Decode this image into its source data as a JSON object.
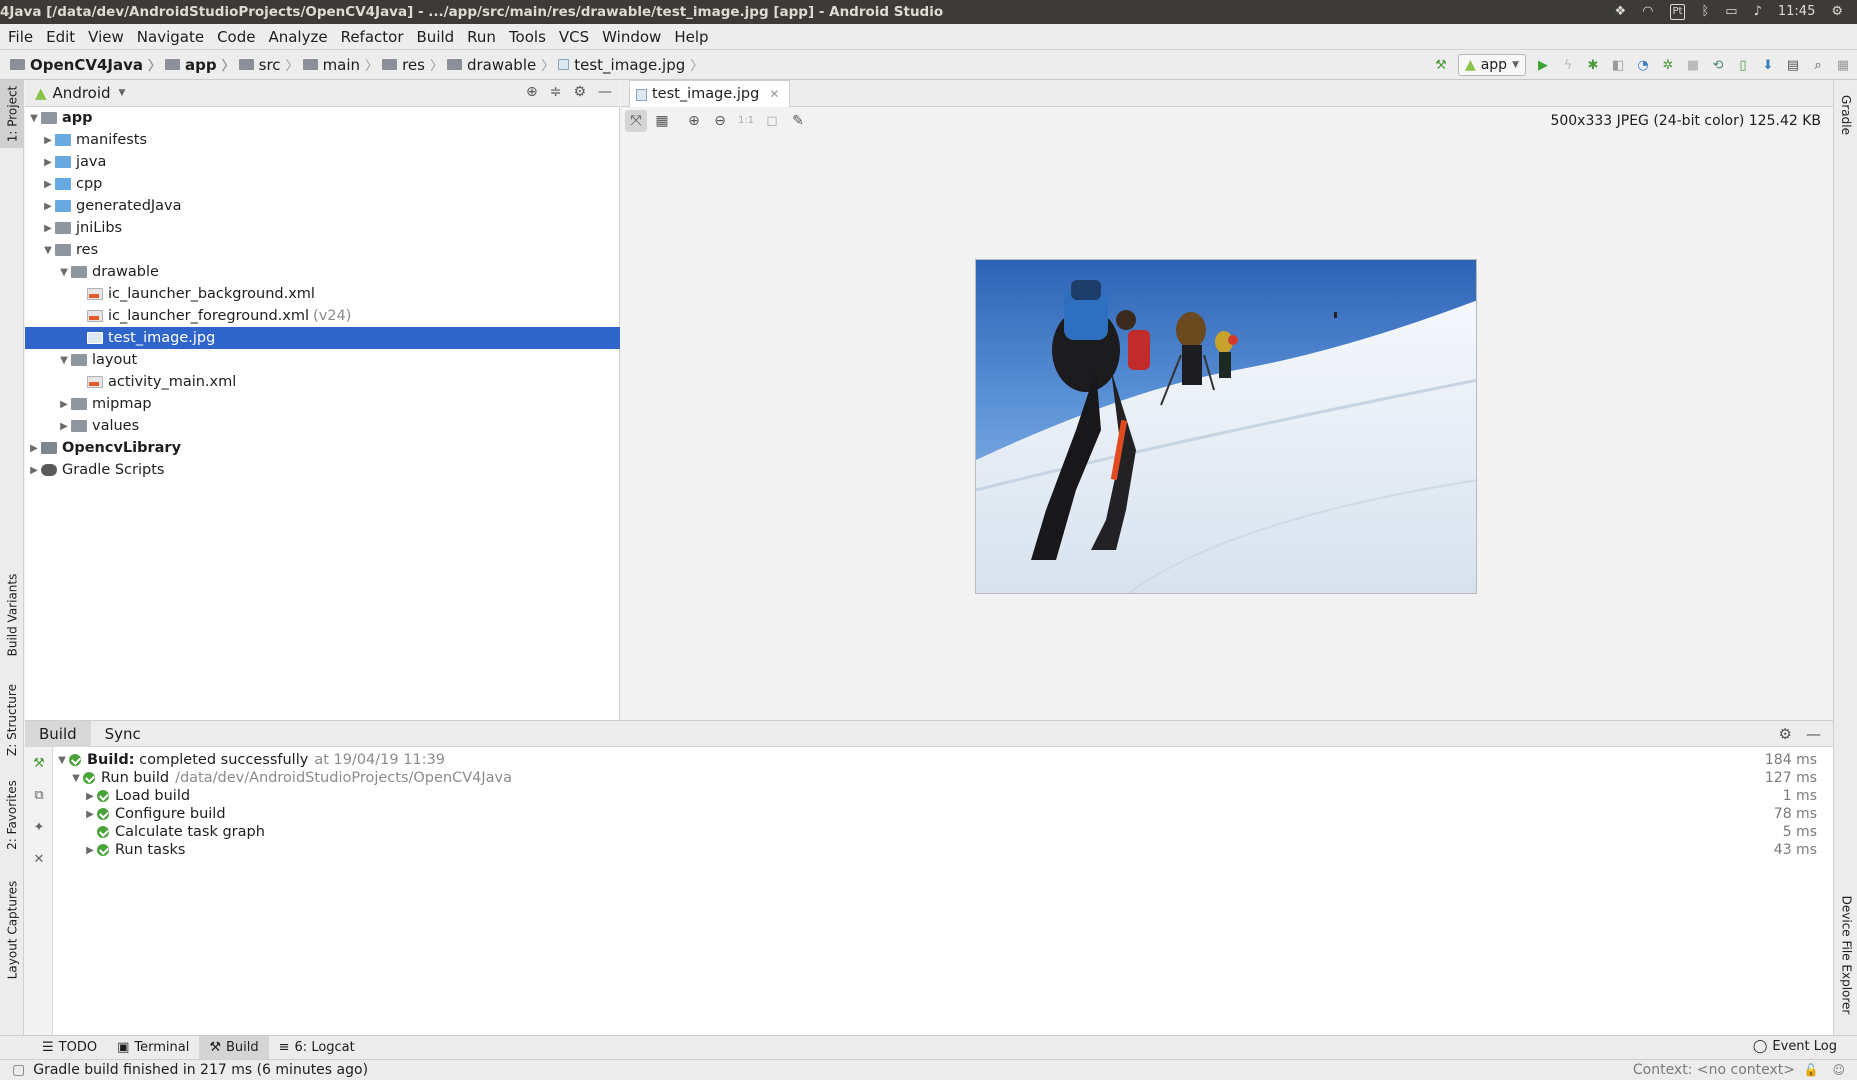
{
  "window": {
    "title": "4Java [/data/dev/AndroidStudioProjects/OpenCV4Java] - .../app/src/main/res/drawable/test_image.jpg [app] - Android Studio",
    "tray_lang": "Pt",
    "clock": "11:45"
  },
  "menu": [
    "File",
    "Edit",
    "View",
    "Navigate",
    "Code",
    "Analyze",
    "Refactor",
    "Build",
    "Run",
    "Tools",
    "VCS",
    "Window",
    "Help"
  ],
  "breadcrumb": [
    "OpenCV4Java",
    "app",
    "src",
    "main",
    "res",
    "drawable",
    "test_image.jpg"
  ],
  "run_config": "app",
  "project_panel": {
    "view_mode": "Android",
    "tree": [
      {
        "label": "app",
        "bold": true
      },
      {
        "label": "manifests"
      },
      {
        "label": "java"
      },
      {
        "label": "cpp"
      },
      {
        "label": "generatedJava"
      },
      {
        "label": "jniLibs"
      },
      {
        "label": "res"
      },
      {
        "label": "drawable"
      },
      {
        "label": "ic_launcher_background.xml"
      },
      {
        "label": "ic_launcher_foreground.xml",
        "suffix": "(v24)"
      },
      {
        "label": "test_image.jpg",
        "selected": true
      },
      {
        "label": "layout"
      },
      {
        "label": "activity_main.xml"
      },
      {
        "label": "mipmap"
      },
      {
        "label": "values"
      },
      {
        "label": "OpencvLibrary",
        "bold": true
      },
      {
        "label": "Gradle Scripts"
      }
    ]
  },
  "editor": {
    "tab": "test_image.jpg",
    "image_info": "500x333 JPEG (24-bit color) 125.42 KB",
    "zoom_label": "1:1"
  },
  "left_tabs": [
    "1: Project",
    "Build Variants",
    "Z: Structure",
    "2: Favorites",
    "Layout Captures"
  ],
  "right_tabs": [
    "Gradle",
    "Device File Explorer"
  ],
  "build_panel": {
    "tabs": [
      "Build",
      "Sync"
    ],
    "rows": [
      {
        "label": "Build:",
        "label2": "completed successfully",
        "extra": "at 19/04/19 11:39",
        "time": "184 ms"
      },
      {
        "label": "Run build",
        "extra": "/data/dev/AndroidStudioProjects/OpenCV4Java",
        "time": "127 ms"
      },
      {
        "label": "Load build",
        "time": "1 ms"
      },
      {
        "label": "Configure build",
        "time": "78 ms"
      },
      {
        "label": "Calculate task graph",
        "time": "5 ms"
      },
      {
        "label": "Run tasks",
        "time": "43 ms"
      }
    ]
  },
  "tool_windows": [
    "TODO",
    "Terminal",
    "Build",
    "6: Logcat"
  ],
  "event_log": "Event Log",
  "status": {
    "message": "Gradle build finished in 217 ms (6 minutes ago)",
    "context": "Context: <no context>"
  }
}
